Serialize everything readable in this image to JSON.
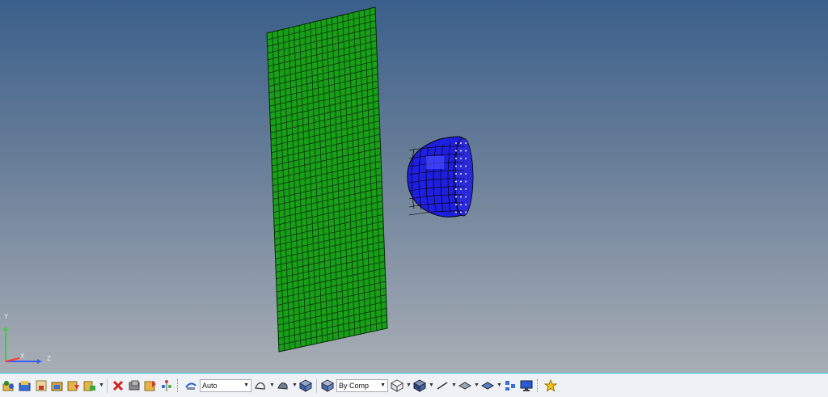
{
  "viewport": {
    "triad": {
      "y_label": "Y",
      "x_label": "X",
      "z_label": "Z"
    },
    "colors": {
      "plate": "#1a9e1a",
      "impactor": "#1f1fe0",
      "mesh_line": "#002a00"
    }
  },
  "toolbar": {
    "display_mode_value": "Auto",
    "color_mode_value": "By Comp",
    "icons": [
      "open-model-icon",
      "import-icon",
      "save-icon",
      "export-icon",
      "flag-down-icon",
      "folder-export-icon",
      "delete-icon",
      "mask-icon",
      "isolate-icon",
      "shortcut-tree-icon",
      "display-mode-icon",
      "wire-shape-icon",
      "shaded-shape-icon",
      "color-mode-icon",
      "cube-wire-icon",
      "cube-solid-icon",
      "line-icon",
      "plane-icon",
      "shaded-plane-icon",
      "network-icon",
      "monitor-icon",
      "star-icon"
    ]
  }
}
